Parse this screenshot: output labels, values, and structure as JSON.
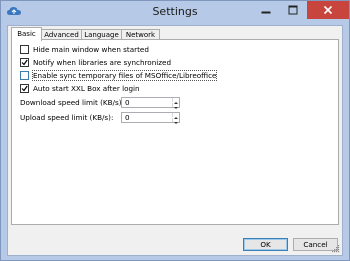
{
  "window": {
    "title": "Settings"
  },
  "tabs": [
    {
      "label": "Basic",
      "active": true
    },
    {
      "label": "Advanced",
      "active": false
    },
    {
      "label": "Language",
      "active": false
    },
    {
      "label": "Network",
      "active": false
    }
  ],
  "options": [
    {
      "label": "Hide main window when started",
      "checked": false
    },
    {
      "label": "Notify when libraries are synchronized",
      "checked": true
    },
    {
      "label": "Enable sync temporary files of MSOffice/Libreoffice",
      "checked": false
    },
    {
      "label": "Auto start XXL Box after login",
      "checked": true
    }
  ],
  "fields": [
    {
      "label": "Download speed limit (KB/s):",
      "value": "0"
    },
    {
      "label": "Upload speed limit (KB/s):",
      "value": "0"
    }
  ],
  "buttons": {
    "ok": "OK",
    "cancel": "Cancel"
  },
  "colors": {
    "titlebar": "#b6c9e6",
    "close": "#c7453d",
    "accent": "#3c7fb1"
  }
}
